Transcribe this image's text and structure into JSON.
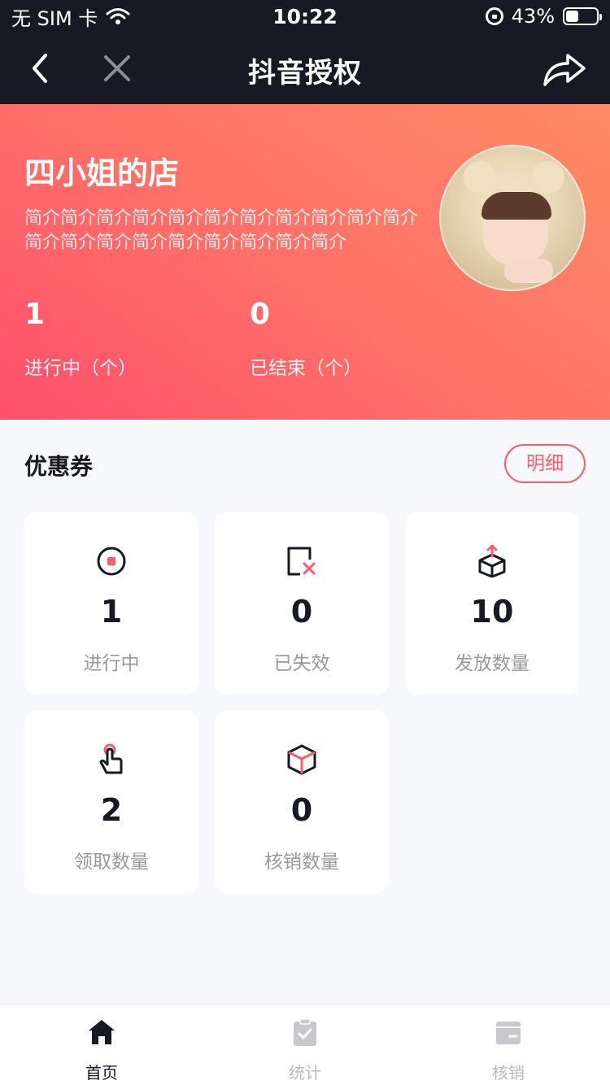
{
  "status_bar": {
    "carrier": "无 SIM 卡",
    "time": "10:22",
    "battery": "43%",
    "battery_level": 0.43
  },
  "nav": {
    "title": "抖音授权",
    "back_icon": "chevron-left-icon",
    "close_icon": "close-icon",
    "share_icon": "share-icon"
  },
  "hero": {
    "shop_name": "四小姐的店",
    "description": "简介简介简介简介简介简介简介简介简介简介简介简介简介简介简介简介简介简介简介简介",
    "stats": [
      {
        "value": "1",
        "label": "进行中（个）"
      },
      {
        "value": "0",
        "label": "已结束（个）"
      }
    ],
    "gradient_colors": [
      "#fe4f6c",
      "#fe8b66"
    ]
  },
  "coupons": {
    "title": "优惠券",
    "detail_label": "明细",
    "cards": [
      {
        "icon": "record-icon",
        "value": "1",
        "label": "进行中"
      },
      {
        "icon": "expired-icon",
        "value": "0",
        "label": "已失效"
      },
      {
        "icon": "box-upload-icon",
        "value": "10",
        "label": "发放数量"
      },
      {
        "icon": "tap-hand-icon",
        "value": "2",
        "label": "领取数量"
      },
      {
        "icon": "box-icon",
        "value": "0",
        "label": "核销数量"
      }
    ]
  },
  "tabbar": {
    "tabs": [
      {
        "label": "首页",
        "icon": "home-icon",
        "active": true
      },
      {
        "label": "统计",
        "icon": "clipboard-check-icon",
        "active": false
      },
      {
        "label": "核销",
        "icon": "wallet-icon",
        "active": false
      }
    ],
    "active_color": "#171a24",
    "inactive_color": "#bbbbbb"
  },
  "colors": {
    "dark": "#171a24",
    "accent": "#fe5b6b",
    "page_bg": "#f7f8fc"
  }
}
